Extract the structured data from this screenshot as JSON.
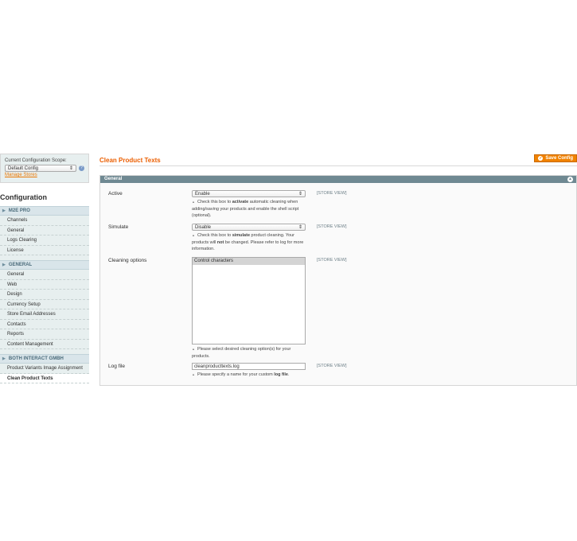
{
  "sidebar": {
    "scope_label": "Current Configuration Scope:",
    "scope_value": "Default Config",
    "manage_stores": "Manage Stores",
    "title": "Configuration",
    "groups": [
      {
        "name": "M2E PRO",
        "items": [
          "Channels",
          "General",
          "Logs Clearing",
          "License"
        ]
      },
      {
        "name": "GENERAL",
        "items": [
          "General",
          "Web",
          "Design",
          "Currency Setup",
          "Store Email Addresses",
          "Contacts",
          "Reports",
          "Content Management"
        ]
      },
      {
        "name": "BOTH INTERACT GMBH",
        "items": [
          "Product Variants Image Assignment",
          "Clean Product Texts"
        ]
      }
    ]
  },
  "header": {
    "title": "Clean Product Texts",
    "save_label": "Save Config"
  },
  "fieldset": {
    "title": "General",
    "fields": {
      "active": {
        "label": "Active",
        "value": "Enable",
        "scope": "[STORE VIEW]",
        "note_pre": "Check this box to ",
        "note_bold": "activate",
        "note_post": " automatic cleaning when adding/saving your products and enable the shell script (optional)."
      },
      "simulate": {
        "label": "Simulate",
        "value": "Disable",
        "scope": "[STORE VIEW]",
        "note_pre": "Check this box to ",
        "note_bold": "simulate",
        "note_mid": " product cleaning. Your products will ",
        "note_bold2": "not",
        "note_post": " be changed. Please refer to log for more information."
      },
      "cleaning": {
        "label": "Cleaning options",
        "option": "Control characters",
        "scope": "[STORE VIEW]",
        "note": "Please select desired cleaning option(s) for your products."
      },
      "logfile": {
        "label": "Log file",
        "value": "cleanproducttexts.log",
        "scope": "[STORE VIEW]",
        "note_pre": "Please specify a name for your custom ",
        "note_bold": "log file",
        "note_post": "."
      }
    }
  }
}
